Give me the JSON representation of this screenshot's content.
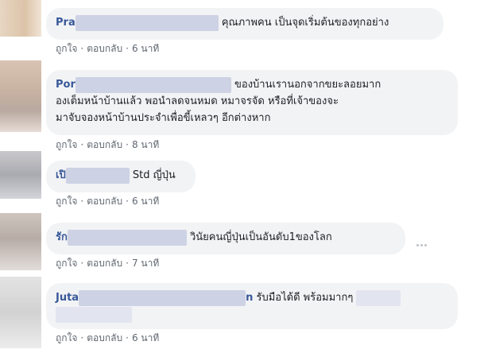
{
  "comments": [
    {
      "name": "Pra",
      "text": "คุณภาพคน เป็นจุดเริ่มต้นของทุกอย่าง",
      "actions": {
        "like": "ถูกใจ",
        "reply": "ตอบกลับ",
        "time": "6 นาที"
      }
    },
    {
      "name": "Por",
      "text_line1": "ของบ้านเรานอกจากขยะลอยมาก",
      "text_line2": "องเต็มหน้าบ้านแล้ว พอนำลดจนหมด หมาจรจัด หรือที่เจ้าของจะ",
      "text_line3": "มาจับจองหน้าบ้านประจำเพื่อขี้เหลวๆ อีกต่างหาก",
      "actions": {
        "like": "ถูกใจ",
        "reply": "ตอบกลับ",
        "time": "8 นาที"
      }
    },
    {
      "name": "เปิ",
      "text": "Std ญี่ปุ่น",
      "actions": {
        "like": "ถูกใจ",
        "reply": "ตอบกลับ",
        "time": "6 นาที"
      }
    },
    {
      "name": "รัก",
      "text": "วินัยคนญี่ปุ่นเป็นอันดับ1ของโลก",
      "actions": {
        "like": "ถูกใจ",
        "reply": "ตอบกลับ",
        "time": "7 นาที"
      }
    },
    {
      "name": "Juta",
      "name_tail": "n",
      "text": "รับมือได้ดี พร้อมมากๆ",
      "actions": {
        "like": "ถูกใจ",
        "reply": "ตอบกลับ",
        "time": "6 นาที"
      }
    }
  ],
  "separator": "·",
  "colors": {
    "bubble": "#f2f3f5",
    "name": "#385898",
    "meta": "#606770"
  }
}
